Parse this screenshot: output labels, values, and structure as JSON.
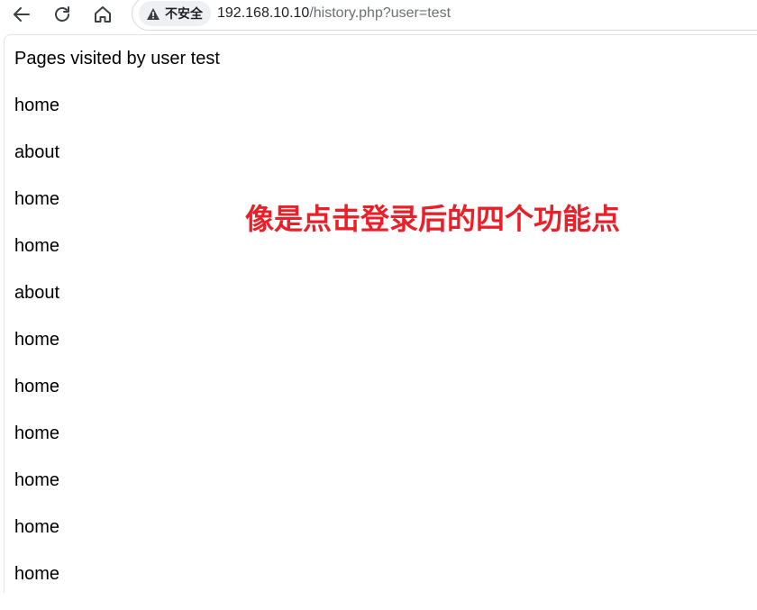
{
  "toolbar": {
    "back_icon": "arrow-left-icon",
    "reload_icon": "reload-icon",
    "home_icon": "home-icon"
  },
  "omnibox": {
    "security_icon": "warning-triangle-icon",
    "security_label": "不安全",
    "url_host": "192.168.10.10",
    "url_path": "/history.php?user=test"
  },
  "page": {
    "heading": "Pages visited by user test",
    "visits": [
      "home",
      "about",
      "home",
      "home",
      "about",
      "home",
      "home",
      "home",
      "home",
      "home",
      "home"
    ]
  },
  "annotation": {
    "text": "像是点击登录后的四个功能点",
    "color": "#e8202a"
  }
}
